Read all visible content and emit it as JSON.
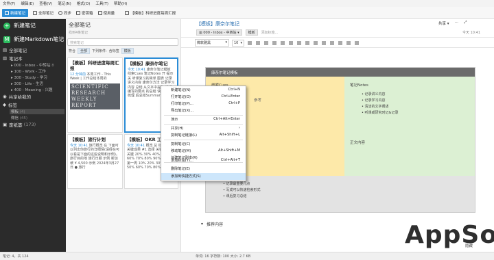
{
  "menubar": [
    "文件(F)",
    "编辑(E)",
    "查看(V)",
    "笔记(N)",
    "格式(O)",
    "工具(T)",
    "帮助(H)"
  ],
  "toolbar": {
    "new_note": "新建笔记",
    "all_notes": "全部笔记",
    "sync": "同步",
    "notebook": "密钥箱",
    "market": "使用量",
    "breadcrumb": "【模板】科研进度每周汇报"
  },
  "sidebar": {
    "new_note": "新建笔记",
    "new_markdown": "新建Markdown笔记",
    "all_notes": "全部笔记",
    "notebooks": "笔记本",
    "nb_items": [
      {
        "label": "000 - Inbox - 中转站",
        "count": "8"
      },
      {
        "label": "100 - Work - 工作",
        "count": ""
      },
      {
        "label": "300 - Study - 学习",
        "count": ""
      },
      {
        "label": "300 - Life - 生活",
        "count": ""
      },
      {
        "label": "400 - Meaning - 兴趣",
        "count": ""
      }
    ],
    "shared": "共享给我的",
    "tags": "标签",
    "tag_items": [
      {
        "label": "模板",
        "count": "(4)"
      },
      {
        "label": "微信",
        "count": "(45)"
      }
    ],
    "trash": "废纸篓",
    "trash_count": "(173)"
  },
  "note_list": {
    "title": "全部笔记",
    "subtitle": "找到4条笔记",
    "search_placeholder": "搜索笔记",
    "filter_label": "符合",
    "filter_all": "全部",
    "filter_cond": "下列条件:",
    "filter_contains": "含标签",
    "filter_tag": "模板"
  },
  "cards": [
    {
      "title": "【模板】科研进度每周汇报",
      "date": "12 分钟前",
      "body": "本周工作 - This Week | 工作总结本周的",
      "image_text": "SCIENTIFIC RESEARCH WEEKLY REPORT"
    },
    {
      "title": "【模板】康奈尔笔记",
      "date": "今天 10:41",
      "body": "康奈尔笔记模板 线索Cues 笔记Notes 开 提示 关 听课复习的简单 图表 记录讲义内容 康奈尔方法 记录学习内容 总结 从文本中提取 课后编写的要点 的总结 快速 文章梳理 后总结Summary"
    },
    {
      "title": "【模板】旅行计划",
      "date": "今天 10:41",
      "body": "旅行概览 在 下面可以列出你旅行的详细情(请经在可以看是下面的这些说明和示例)。旅行目的地 旅行日期 示例 新加坡 ¥ 4,500 示例 2024年3月27日 ● 旅行"
    },
    {
      "title": "【模板】OKR 工",
      "date": "今天 10:41",
      "body": "概览 总 标 目标和关键成果 #1 选择 关键成果 1 关键 20% 30% 40% 50% 60% 70% 80% 90% 100% 第一周 10% 20% 30% 40% 50% 60% 70% 80%"
    }
  ],
  "editor": {
    "title": "【模板】康奈尔笔记",
    "notebook": "000 - Inbox - 中转站",
    "tag": "模板",
    "tag_add": "添加标签...",
    "share": "共享",
    "time": "今天 10:41",
    "font": "微软雅黑",
    "font_size": "10"
  },
  "template": {
    "header": "康奈尔笔记模板",
    "cues": "线索Cues",
    "notes": "笔记Notes",
    "summary": "正文内容",
    "cues_hint": "参考",
    "notes_list": [
      "记录讲义内容",
      "记录学习内容",
      "清洁的文字阐述",
      "听课或研究时记&记录"
    ],
    "summary_list": [
      "记录最重要几点",
      "写成可以快速检索形式",
      "课后复习总结"
    ]
  },
  "recommend": "推荐内容",
  "status": {
    "left": "笔记: 4，共 124",
    "right": "单词: 16   字符数: 100   大小: 2.7 KB"
  },
  "context_menu": [
    {
      "label": "新建笔记(N)",
      "shortcut": "Ctrl+N"
    },
    {
      "label": "打开笔记(O)",
      "shortcut": "Ctrl+Enter"
    },
    {
      "label": "打印笔记(P)...",
      "shortcut": "Ctrl+P"
    },
    {
      "label": "导出笔记(X)...",
      "shortcut": ""
    },
    {
      "label": "演示",
      "shortcut": "Ctrl+Alt+Enter"
    },
    {
      "label": "共享(H)",
      "shortcut": ""
    },
    {
      "label": "复制笔记链接(L)",
      "shortcut": "Alt+Shift+L"
    },
    {
      "label": "复制笔记(C)",
      "shortcut": ""
    },
    {
      "label": "移动笔记(M)",
      "shortcut": "Alt+Shift+M"
    },
    {
      "label": "创建笔记副本(R)",
      "shortcut": ""
    },
    {
      "label": "添加标签(T)...",
      "shortcut": "Ctrl+Alt+T"
    },
    {
      "label": "删除笔记(E)",
      "shortcut": ""
    },
    {
      "label": "添加到快捷方式(S)",
      "shortcut": ""
    }
  ],
  "watermark": {
    "text": "AppSo",
    "sub": "隐藏"
  },
  "colors": {
    "accent": "#2a8cd6",
    "sidebar": "#2b2b2b",
    "green": "#2dbe60",
    "yellow": "#fde9a9",
    "mint": "#dcf0d3"
  }
}
